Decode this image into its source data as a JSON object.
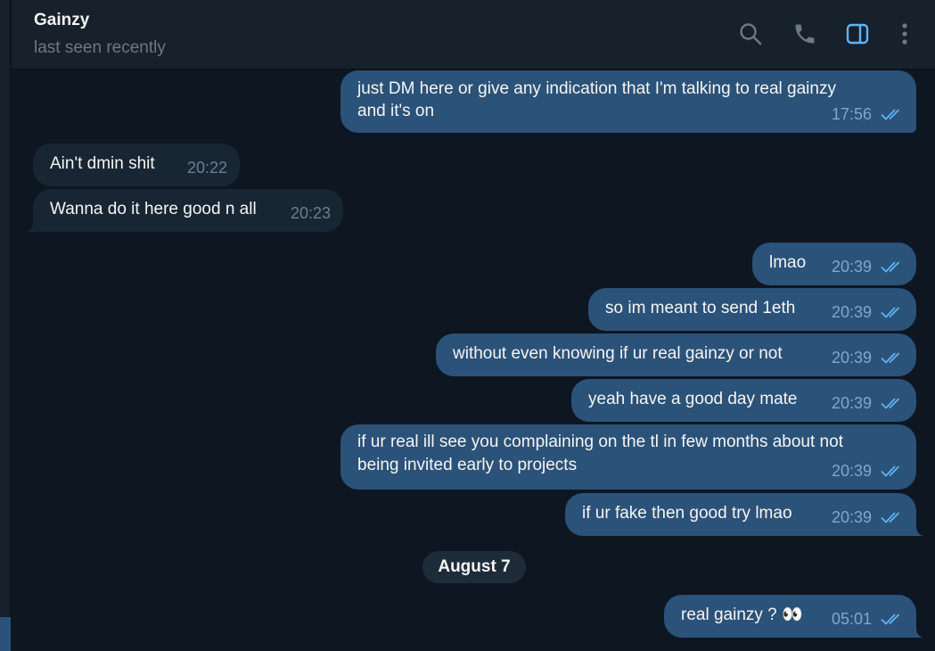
{
  "header": {
    "name": "Gainzy",
    "status": "last seen recently"
  },
  "messages": [
    {
      "direction": "out",
      "text_lines": [
        "just DM here or give any indication that I'm talking to real gainzy",
        "and it's on"
      ],
      "time": "17:56",
      "ticks": "read"
    },
    {
      "direction": "in",
      "text_lines": [
        "Ain't dmin shit"
      ],
      "time": "20:22"
    },
    {
      "direction": "in",
      "text_lines": [
        "Wanna do it here good n all"
      ],
      "time": "20:23"
    },
    {
      "direction": "out",
      "text_lines": [
        "lmao"
      ],
      "time": "20:39",
      "ticks": "read"
    },
    {
      "direction": "out",
      "text_lines": [
        "so im meant to send 1eth"
      ],
      "time": "20:39",
      "ticks": "read"
    },
    {
      "direction": "out",
      "text_lines": [
        "without even knowing if ur real gainzy or not"
      ],
      "time": "20:39",
      "ticks": "read"
    },
    {
      "direction": "out",
      "text_lines": [
        "yeah have a good day mate"
      ],
      "time": "20:39",
      "ticks": "read"
    },
    {
      "direction": "out",
      "text_lines": [
        "if ur real ill see you complaining on the tl in few months about not",
        "being invited early to projects"
      ],
      "time": "20:39",
      "ticks": "read"
    },
    {
      "direction": "out",
      "text_lines": [
        "if ur fake then good try lmao"
      ],
      "time": "20:39",
      "ticks": "read"
    },
    {
      "direction": "out",
      "text_lines": [
        "real gainzy ? 👀"
      ],
      "time": "05:01",
      "ticks": "read"
    }
  ],
  "date_separator": "August 7",
  "icons": {
    "search": "search-icon",
    "call": "phone-icon",
    "sidebar": "sidebar-toggle-icon",
    "menu": "more-vertical-icon",
    "read": "double-check-icon"
  },
  "colors": {
    "background": "#0e1621",
    "header": "#17212b",
    "outgoing_bubble": "#2b5278",
    "incoming_bubble": "#182533",
    "accent": "#5eb5f7",
    "meta_out": "#7da8d3"
  }
}
